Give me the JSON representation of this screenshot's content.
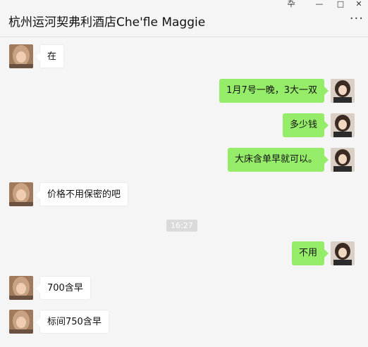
{
  "window": {
    "title": "杭州运河契弗利酒店Che'fle Maggie",
    "pin_glyph": "卆",
    "minimize_glyph": "—",
    "maximize_glyph": "□",
    "more_glyph": "···"
  },
  "colors": {
    "background": "#f5f5f5",
    "outgoing_bubble": "#95ec69",
    "incoming_bubble": "#ffffff",
    "timestamp_bg": "#dadada"
  },
  "messages": [
    {
      "side": "in",
      "text": "在"
    },
    {
      "side": "out",
      "text": "1月7号一晚，3大一双"
    },
    {
      "side": "out",
      "text": "多少钱"
    },
    {
      "side": "out",
      "text": "大床含单早就可以。"
    },
    {
      "side": "in",
      "text": "价格不用保密的吧"
    },
    {
      "side": "time",
      "text": "16:27"
    },
    {
      "side": "out",
      "text": "不用"
    },
    {
      "side": "in",
      "text": "700含早"
    },
    {
      "side": "in",
      "text": "标间750含早"
    }
  ]
}
